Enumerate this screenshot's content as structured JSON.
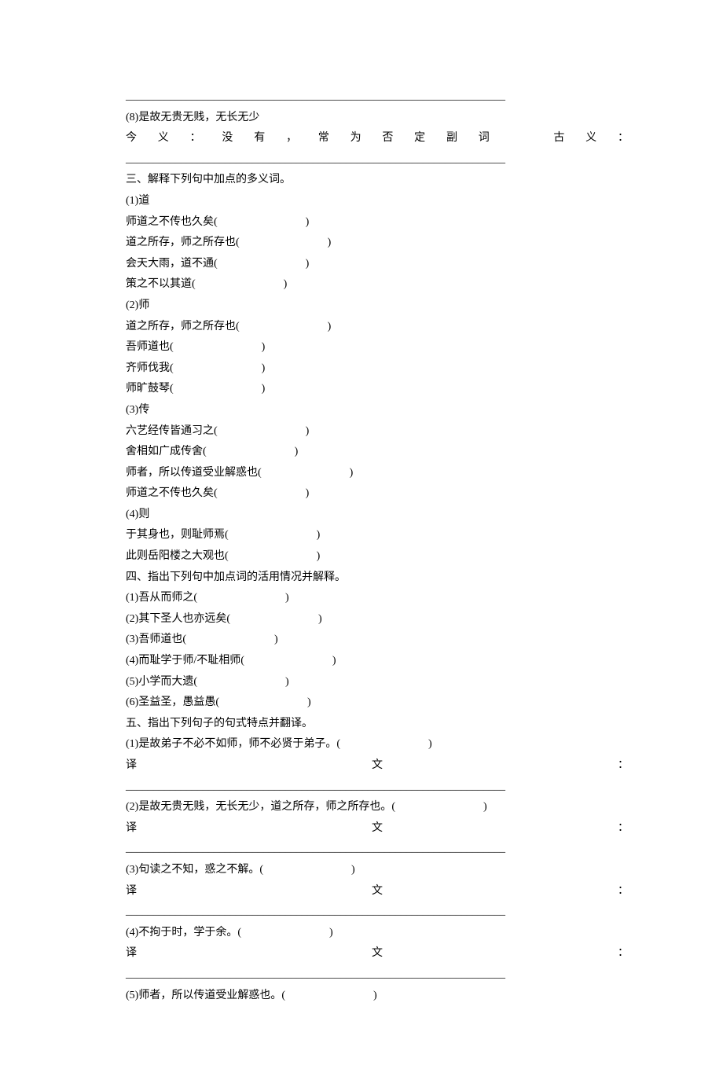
{
  "top_rule": "_____________________________________________________________________",
  "item8": {
    "title": "(8)是故无贵无贱，无长无少",
    "note_parts": {
      "a": "今",
      "b": "义",
      "c": "：",
      "d": "没",
      "e": "有",
      "f": "，",
      "g": "常",
      "h": "为",
      "i": "否",
      "j": "定",
      "k": "副",
      "l": "词",
      "m": "古",
      "n": "义",
      "o": "："
    }
  },
  "rule2": "_____________________________________________________________________",
  "s3": {
    "header": "三、解释下列句中加点的多义词。",
    "q1": {
      "label": "(1)道",
      "l1": "师道之不传也久矣(　　　　　　　　)",
      "l2": "道之所存，师之所存也(　　　　　　　　)",
      "l3": "会天大雨，道不通(　　　　　　　　)",
      "l4": "策之不以其道(　　　　　　　　)"
    },
    "q2": {
      "label": "(2)师",
      "l1": "道之所存，师之所存也(　　　　　　　　)",
      "l2": "吾师道也(　　　　　　　　)",
      "l3": "齐师伐我(　　　　　　　　)",
      "l4": "师旷鼓琴(　　　　　　　　)"
    },
    "q3": {
      "label": "(3)传",
      "l1": "六艺经传皆通习之(　　　　　　　　)",
      "l2": "舍相如广成传舍(　　　　　　　　)",
      "l3": "师者，所以传道受业解惑也(　　　　　　　　)",
      "l4": "师道之不传也久矣(　　　　　　　　)"
    },
    "q4": {
      "label": "(4)则",
      "l1": "于其身也，则耻师焉(　　　　　　　　)",
      "l2": "此则岳阳楼之大观也(　　　　　　　　)"
    }
  },
  "s4": {
    "header": "四、指出下列句中加点词的活用情况并解释。",
    "l1": "(1)吾从而师之(　　　　　　　　)",
    "l2": "(2)其下圣人也亦远矣(　　　　　　　　)",
    "l3": "(3)吾师道也(　　　　　　　　)",
    "l4": "(4)而耻学于师/不耻相师(　　　　　　　　)",
    "l5": "(5)小学而大遗(　　　　　　　　)",
    "l6": "(6)圣益圣，愚益愚(　　　　　　　　)"
  },
  "s5": {
    "header": "五、指出下列句子的句式特点并翻译。",
    "q1": {
      "line": "(1)是故弟子不必不如师，师不必贤于弟子。(　　　　　　　　)",
      "yi": "译",
      "wen": "文",
      "colon": "："
    },
    "q2": {
      "line": "(2)是故无贵无贱，无长无少，道之所存，师之所存也。(　　　　　　　　)",
      "yi": "译",
      "wen": "文",
      "colon": "："
    },
    "q3": {
      "line": "(3)句读之不知，惑之不解。(　　　　　　　　)",
      "yi": "译",
      "wen": "文",
      "colon": "："
    },
    "q4": {
      "line": "(4)不拘于时，学于余。(　　　　　　　　)",
      "yi": "译",
      "wen": "文",
      "colon": "："
    },
    "q5": {
      "line": "(5)师者，所以传道受业解惑也。(　　　　　　　　)"
    }
  },
  "rule_blank": "_____________________________________________________________________"
}
